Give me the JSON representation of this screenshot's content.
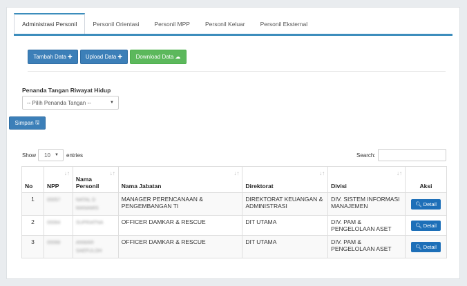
{
  "tabs": [
    {
      "label": "Administrasi Personil"
    },
    {
      "label": "Personil Orientasi"
    },
    {
      "label": "Personil MPP"
    },
    {
      "label": "Personil Keluar"
    },
    {
      "label": "Personil Eksternal"
    }
  ],
  "actions": {
    "tambah_label": "Tambah Data",
    "upload_label": "Upload Data",
    "download_label": "Download Data"
  },
  "penanda": {
    "label": "Penanda Tangan Riwayat Hidup",
    "select_value": "-- Pilih Penanda Tangan --",
    "simpan_label": "Simpan"
  },
  "table_controls": {
    "show_label": "Show",
    "entries_value": "10",
    "entries_label": "entries",
    "search_label": "Search:"
  },
  "table": {
    "headers": [
      "No",
      "NPP",
      "Nama Personil",
      "Nama Jabatan",
      "Direktorat",
      "Divisi",
      "Aksi"
    ],
    "rows": [
      {
        "no": "1",
        "npp": "00057",
        "nama": "NATAL D MANAMIS",
        "jabatan": "MANAGER PERENCANAAN & PENGEMBANGAN TI",
        "direktorat": "DIREKTORAT KEUANGAN & ADMINISTRASI",
        "divisi": "DIV. SISTEM INFORMASI MANAJEMEN",
        "aksi": "Detail"
      },
      {
        "no": "2",
        "npp": "00064",
        "nama": "SUPRIATNA",
        "jabatan": "OFFICER DAMKAR & RESCUE",
        "direktorat": "DIT UTAMA",
        "divisi": "DIV. PAM & PENGELOLAAN ASET",
        "aksi": "Detail"
      },
      {
        "no": "3",
        "npp": "00066",
        "nama": "ANWAR SAEFULOH",
        "jabatan": "OFFICER DAMKAR & RESCUE",
        "direktorat": "DIT UTAMA",
        "divisi": "DIV. PAM & PENGELOLAAN ASET",
        "aksi": "Detail"
      }
    ]
  },
  "colors": {
    "primary": "#3c7fb8",
    "success": "#5cb85c",
    "accent": "#3c8dbc"
  }
}
